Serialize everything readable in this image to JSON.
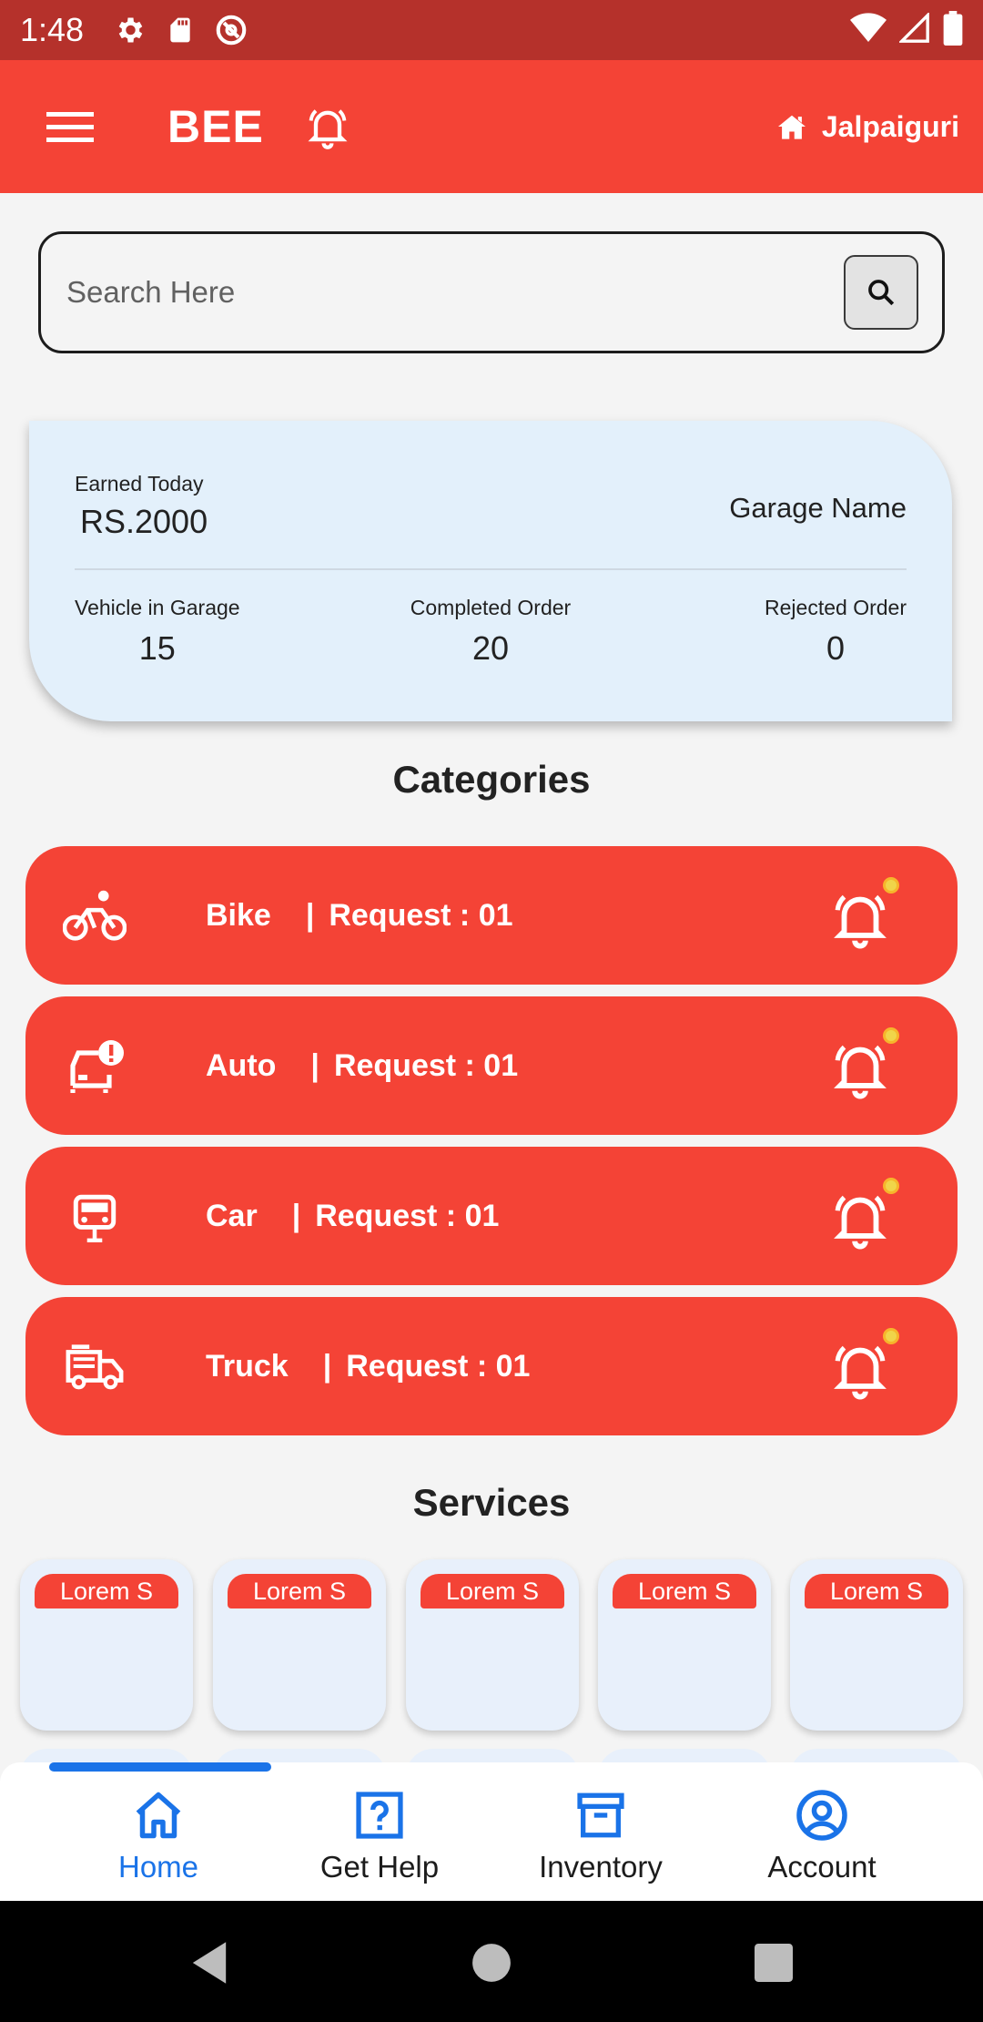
{
  "status_bar": {
    "time": "1:48",
    "icons": [
      "settings-icon",
      "sd-card-icon",
      "at-sign-icon",
      "wifi-icon",
      "signal-icon",
      "battery-icon"
    ]
  },
  "app_bar": {
    "title": "BEE",
    "location": "Jalpaiguri",
    "colors": {
      "primary": "#f44336",
      "status": "#b5312b"
    }
  },
  "search": {
    "placeholder": "Search Here",
    "value": ""
  },
  "stats": {
    "earned_label": "Earned Today",
    "earned_value": "RS.2000",
    "garage_name": "Garage Name",
    "vehicle_label": "Vehicle in Garage",
    "vehicle_value": "15",
    "completed_label": "Completed Order",
    "completed_value": "20",
    "rejected_label": "Rejected Order",
    "rejected_value": "0"
  },
  "categories": {
    "title": "Categories",
    "items": [
      {
        "name": "Bike",
        "separator": "|",
        "request": "Request : 01",
        "icon": "bike-icon"
      },
      {
        "name": "Auto",
        "separator": "|",
        "request": "Request : 01",
        "icon": "auto-alert-icon"
      },
      {
        "name": "Car",
        "separator": "|",
        "request": "Request : 01",
        "icon": "car-icon"
      },
      {
        "name": "Truck",
        "separator": "|",
        "request": "Request : 01",
        "icon": "truck-icon"
      }
    ]
  },
  "services": {
    "title": "Services",
    "items": [
      "Lorem S",
      "Lorem S",
      "Lorem S",
      "Lorem S",
      "Lorem S"
    ]
  },
  "bottom_nav": {
    "active": "Home",
    "active_color": "#1a73e8",
    "items": [
      {
        "label": "Home",
        "icon": "home-icon"
      },
      {
        "label": "Get Help",
        "icon": "help-icon"
      },
      {
        "label": "Inventory",
        "icon": "inventory-icon"
      },
      {
        "label": "Account",
        "icon": "account-icon"
      }
    ]
  }
}
